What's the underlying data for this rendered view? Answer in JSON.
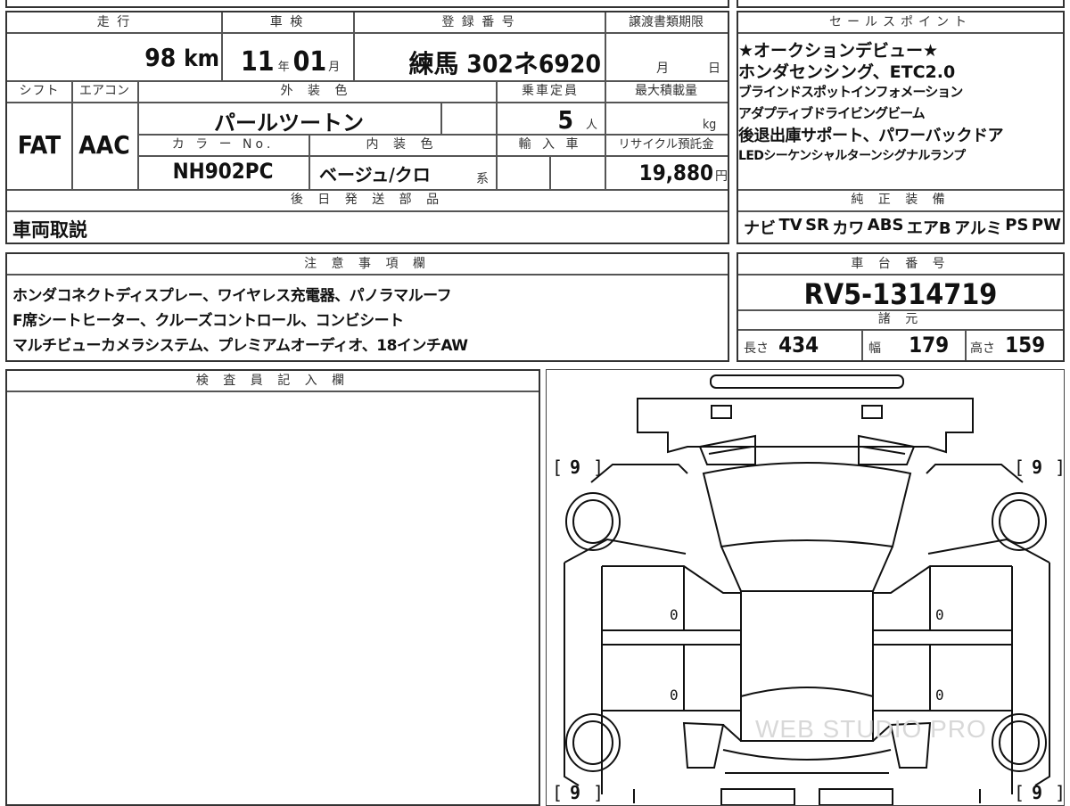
{
  "main": {
    "mileage_label": "走 行",
    "mileage_value": "98",
    "mileage_unit": "km",
    "shaken_label": "車 検",
    "shaken_year": "11",
    "shaken_year_unit": "年",
    "shaken_month": "01",
    "shaken_month_unit": "月",
    "reg_label": "登 録 番 号",
    "reg_value": "練馬 302ネ6920",
    "deadline_label": "譲渡書類期限",
    "deadline_month": "月",
    "deadline_day": "日",
    "shift_label": "シフト",
    "shift_value": "FAT",
    "ac_label": "エアコン",
    "ac_value": "AAC",
    "exterior_label": "外 装 色",
    "exterior_value": "パールツートン",
    "capacity_label": "乗車定員",
    "capacity_value": "5",
    "capacity_unit": "人",
    "maxload_label": "最大積載量",
    "maxload_unit": "kg",
    "colorno_label": "カ ラ ー No.",
    "colorno_value": "NH902PC",
    "interior_label": "内 装 色",
    "interior_value": "ベージュ/クロ",
    "interior_suffix": "系",
    "import_label": "輸 入 車",
    "recycle_label": "リサイクル預託金",
    "recycle_value": "19,880",
    "recycle_unit": "円",
    "parts_label": "後 日 発 送 部 品",
    "parts_value": "車両取説"
  },
  "sales": {
    "title": "セールスポイント",
    "lines": [
      "★オークションデビュー★",
      "ホンダセンシング、ETC2.0",
      "ブラインドスポットインフォメーション",
      "アダプティブドライビングビーム",
      "後退出庫サポート、パワーバックドア",
      "LEDシーケンシャルターンシグナルランプ"
    ]
  },
  "equipment": {
    "title": "純 正 装 備",
    "items": [
      "ナビ",
      "TV",
      "SR",
      "カワ",
      "ABS",
      "エアB",
      "アルミ",
      "PS",
      "PW"
    ]
  },
  "notes": {
    "title": "注 意 事 項 欄",
    "lines": [
      "ホンダコネクトディスプレー、ワイヤレス充電器、パノラマルーフ",
      "F席シートヒーター、クルーズコントロール、コンビシート",
      "マルチビューカメラシステム、プレミアムオーディオ、18インチAW"
    ]
  },
  "chassis": {
    "title": "車 台 番 号",
    "value": "RV5-1314719",
    "spec_title": "諸 元",
    "length_label": "長さ",
    "length_value": "434",
    "width_label": "幅",
    "width_value": "179",
    "height_label": "高さ",
    "height_value": "159"
  },
  "inspector": {
    "title": "検 査 員 記 入 欄"
  },
  "diagram": {
    "tread_values": [
      "9",
      "9",
      "9",
      "9"
    ],
    "door_values": [
      "0",
      "0",
      "0",
      "0"
    ],
    "watermark": "WEB STUDIO PRO"
  }
}
